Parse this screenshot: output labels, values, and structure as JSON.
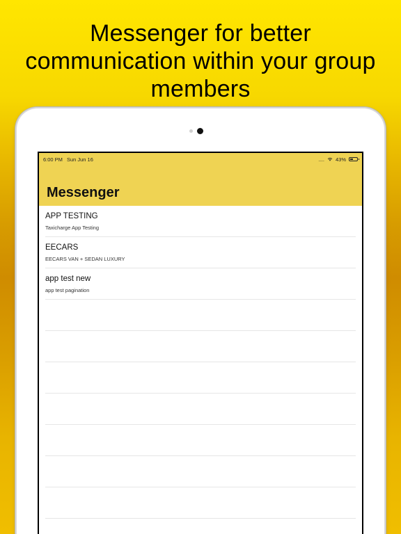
{
  "headline": {
    "line1": "Messenger for better",
    "line2": "communication within your group",
    "line3": "members"
  },
  "status_bar": {
    "time": "6:00 PM",
    "date": "Sun Jun 16",
    "signal": "....",
    "battery": "43%",
    "battery_level": 0.43
  },
  "nav": {
    "title": "Messenger"
  },
  "conversations": [
    {
      "title": "APP TESTING",
      "subtitle": "Taxicharge App Testing"
    },
    {
      "title": "EECARS",
      "subtitle": "EECARS VAN + SEDAN LUXURY"
    },
    {
      "title": "app test new",
      "subtitle": "app test pagination"
    }
  ],
  "colors": {
    "accent": "#efd353",
    "background_top": "#ffe600",
    "background_mid": "#cf8c00"
  },
  "icons": {
    "wifi": "wifi-icon",
    "battery": "battery-icon"
  }
}
